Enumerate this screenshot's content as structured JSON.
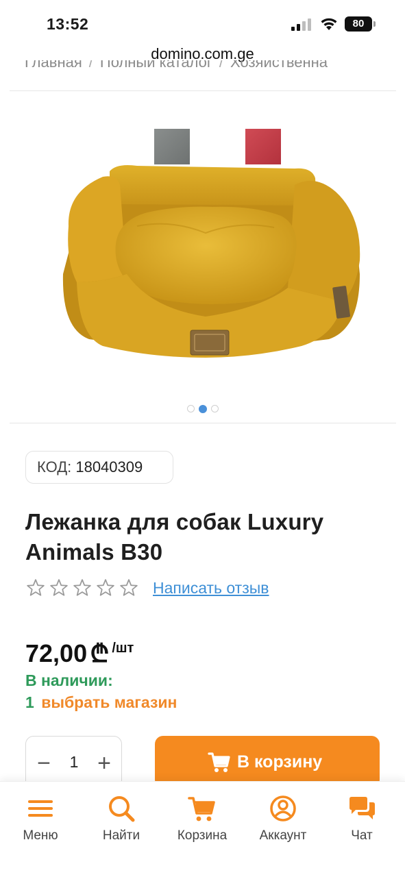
{
  "status_bar": {
    "time": "13:52",
    "battery": "80"
  },
  "browser": {
    "url": "domino.com.ge"
  },
  "breadcrumb": {
    "items": [
      "Главная",
      "Полный каталог",
      "Хозяйственна"
    ],
    "separator": "/"
  },
  "gallery": {
    "swatches": [
      {
        "name": "gray",
        "color": "#7c807f"
      },
      {
        "name": "red",
        "color": "#c53f49"
      }
    ],
    "product_color": "#d6a51c",
    "active_slide": 2,
    "slide_count": 3
  },
  "product": {
    "code_label": "КОД:",
    "code_value": "18040309",
    "title": "Лежанка для собак Luxury Animals B30",
    "rating_stars": 0,
    "rating_max": 5,
    "review_link": "Написать отзыв",
    "price": "72,00",
    "currency_symbol": "₾",
    "price_unit": "/шт",
    "stock_label": "В наличии:",
    "store_count": "1",
    "store_link": "выбрать магазин",
    "quantity": "1",
    "cart_button_label": "В корзину"
  },
  "colors": {
    "accent_orange": "#f58a1f",
    "stock_green": "#2e9a5a",
    "link_blue": "#3e8fd6"
  },
  "bottom_nav": {
    "items": [
      {
        "label": "Меню",
        "icon": "menu-icon"
      },
      {
        "label": "Найти",
        "icon": "search-icon"
      },
      {
        "label": "Корзина",
        "icon": "cart-icon"
      },
      {
        "label": "Аккаунт",
        "icon": "account-icon"
      },
      {
        "label": "Чат",
        "icon": "chat-icon"
      }
    ]
  }
}
